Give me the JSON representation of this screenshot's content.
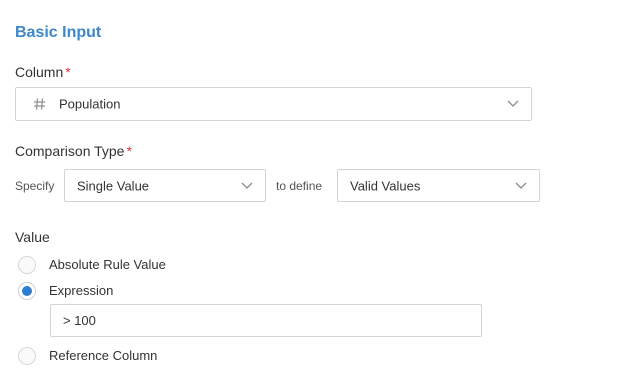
{
  "section": {
    "title": "Basic Input"
  },
  "column": {
    "label": "Column",
    "required_mark": "*",
    "selected": "Population",
    "type_icon": "hash-icon"
  },
  "comparison": {
    "label": "Comparison Type",
    "required_mark": "*",
    "specify_text": "Specify",
    "specify_value": "Single Value",
    "to_define_text": "to define",
    "define_value": "Valid Values"
  },
  "value": {
    "label": "Value",
    "options": [
      {
        "label": "Absolute Rule Value",
        "selected": false
      },
      {
        "label": "Expression",
        "selected": true
      },
      {
        "label": "Reference Column",
        "selected": false
      }
    ],
    "expression_input_value": "> 100"
  },
  "colors": {
    "accent": "#3d87c9",
    "required": "#d93a3a",
    "radio_selected": "#2f7dd1",
    "border": "#d4d4d4"
  }
}
